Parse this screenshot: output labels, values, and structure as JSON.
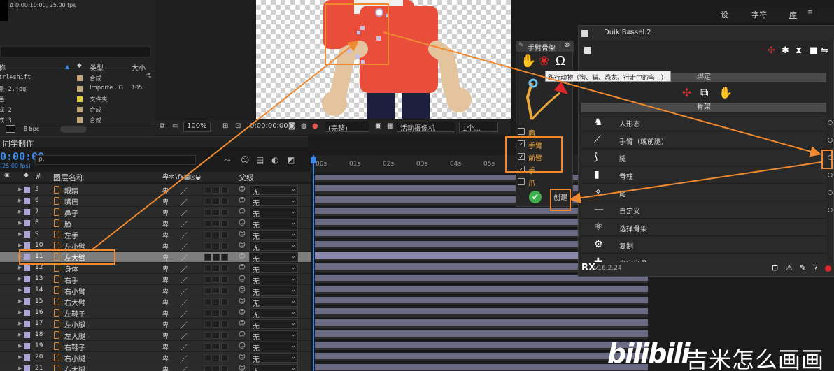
{
  "project": {
    "info": "Δ 0:00:10:00, 25.00 fps",
    "columns": {
      "name": "称",
      "type": "类型",
      "size": "大小"
    },
    "rows": [
      {
        "name": "trl+shift",
        "type": "合成",
        "size": "",
        "color": "#c2a878"
      },
      {
        "name": "景-2.jpg",
        "type": "Importe...G",
        "size": "105",
        "color": "#c2a878"
      },
      {
        "name": "色",
        "type": "文件夹",
        "size": "",
        "color": "#e1cf3b"
      },
      {
        "name": "成 2",
        "type": "合成",
        "size": "",
        "color": "#c2a878"
      },
      {
        "name": "成 3",
        "type": "合成",
        "size": "",
        "color": "#c2a878"
      }
    ],
    "bpc": "8 bpc"
  },
  "viewer": {
    "zoom": "100%",
    "timecode": "0:00:00:00",
    "quality": "(完整)",
    "camera": "活动摄像机",
    "views": "1个..."
  },
  "timeline": {
    "comp_title": "同学制作",
    "current_time": "0:00:00",
    "fps_label": "(25.00 fps)",
    "search_placeholder": "ρ.",
    "ruler": [
      "00s",
      "01s",
      "02s",
      "03s",
      "04s",
      "05s",
      "06"
    ],
    "col_layer_name": "图层名称",
    "col_parent": "父级",
    "col_hash": "#",
    "parent_none": "无",
    "layers": [
      {
        "num": "5",
        "name": "眼睛"
      },
      {
        "num": "6",
        "name": "嘴巴"
      },
      {
        "num": "7",
        "name": "鼻子"
      },
      {
        "num": "8",
        "name": "脸"
      },
      {
        "num": "9",
        "name": "左手"
      },
      {
        "num": "10",
        "name": "左小臂"
      },
      {
        "num": "11",
        "name": "左大臂",
        "selected": true
      },
      {
        "num": "12",
        "name": "身体"
      },
      {
        "num": "13",
        "name": "右手"
      },
      {
        "num": "14",
        "name": "右小臂"
      },
      {
        "num": "15",
        "name": "右大臂"
      },
      {
        "num": "16",
        "name": "左鞋子"
      },
      {
        "num": "17",
        "name": "左小腿"
      },
      {
        "num": "18",
        "name": "左大腿"
      },
      {
        "num": "19",
        "name": "右鞋子"
      },
      {
        "num": "20",
        "name": "右小腿"
      },
      {
        "num": "21",
        "name": "右大腿"
      }
    ]
  },
  "arm_panel": {
    "title": "手臂骨架",
    "options": [
      {
        "label": "肩",
        "checked": false
      },
      {
        "label": "手臂",
        "checked": true
      },
      {
        "label": "前臂",
        "checked": true
      },
      {
        "label": "手",
        "checked": true
      },
      {
        "label": "爪",
        "checked": false
      }
    ],
    "create_label": "创建"
  },
  "tooltip": "跖行动物（狗、猫、恐龙、行走中的鸟...）",
  "duik": {
    "title": "Duik Bassel.2",
    "section_bind": "绑定",
    "section_rig": "骨架",
    "items": [
      {
        "label": "人形态",
        "icon": "human-rig-icon"
      },
      {
        "label": "手臂（或前腿）",
        "icon": "arm-rig-icon"
      },
      {
        "label": "腿",
        "icon": "leg-rig-icon"
      },
      {
        "label": "脊柱",
        "icon": "spine-rig-icon"
      },
      {
        "label": "尾",
        "icon": "tail-rig-icon"
      },
      {
        "label": "自定义",
        "icon": "custom-rig-icon"
      },
      {
        "label": "选择骨架",
        "icon": "select-rig-icon"
      },
      {
        "label": "复制",
        "icon": "duplicate-icon"
      },
      {
        "label": "自定义骨",
        "icon": "custom-bone-icon"
      }
    ],
    "version": "v16.2.24"
  },
  "right_tabs": [
    "设",
    "字符",
    "库"
  ],
  "watermark": {
    "logo": "bilibili",
    "text": "吉米怎么画画"
  },
  "colors": {
    "accent_blue": "#3c8ce6",
    "highlight_orange": "#f0892f",
    "duik_red": "#e0262a",
    "layer_label": "#a9a6d6"
  }
}
